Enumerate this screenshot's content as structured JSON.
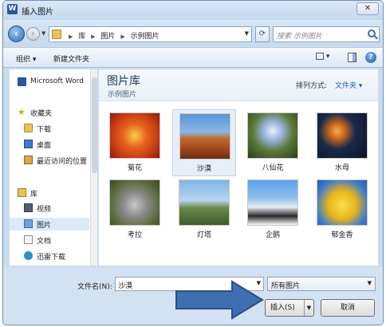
{
  "window": {
    "title": "插入图片",
    "close_glyph": "✕",
    "app_icon_letter": "W"
  },
  "address": {
    "crumbs": [
      "库",
      "图片",
      "示例图片"
    ],
    "search_placeholder": "搜索 示例图片"
  },
  "toolbar": {
    "organize_label": "组织 ▾",
    "new_folder_label": "新建文件夹",
    "help_glyph": "?"
  },
  "sidebar": {
    "items": [
      {
        "label": "Microsoft Word",
        "icon": "word-icon"
      },
      {
        "label": "收藏夹",
        "icon": "star-icon"
      },
      {
        "label": "下载",
        "icon": "folder-icon"
      },
      {
        "label": "桌面",
        "icon": "desktop-icon"
      },
      {
        "label": "最近访问的位置",
        "icon": "recent-places-icon"
      },
      {
        "label": "库",
        "icon": "library-icon"
      },
      {
        "label": "视频",
        "icon": "video-icon"
      },
      {
        "label": "图片",
        "icon": "pictures-icon"
      },
      {
        "label": "文档",
        "icon": "documents-icon"
      },
      {
        "label": "迅雷下载",
        "icon": "xunlei-icon"
      }
    ]
  },
  "library": {
    "title": "图片库",
    "subtitle": "示例图片",
    "arrange_label": "排列方式:",
    "arrange_value": "文件夹 ▾"
  },
  "pictures": [
    {
      "name": "菊花"
    },
    {
      "name": "沙漠"
    },
    {
      "name": "八仙花"
    },
    {
      "name": "水母"
    },
    {
      "name": "考拉"
    },
    {
      "name": "灯塔"
    },
    {
      "name": "企鹅"
    },
    {
      "name": "郁金香"
    }
  ],
  "bottom": {
    "filename_label": "文件名(N):",
    "filename_value": "沙漠",
    "filetype_value": "所有图片",
    "insert_label": "插入(S)",
    "cancel_label": "取消"
  },
  "colors": {
    "accent": "#1a5fb4",
    "arrow_fill": "#3f6fb0"
  }
}
